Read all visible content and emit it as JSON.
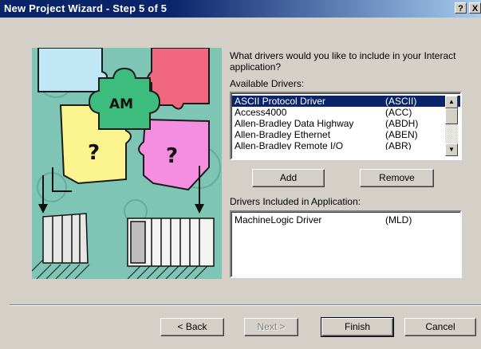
{
  "window": {
    "title": "New Project Wizard - Step 5 of 5",
    "help_label": "?",
    "close_label": "X"
  },
  "illustration": {
    "label_am": "AM",
    "label_q1": "?",
    "label_q2": "?"
  },
  "prompt": "What drivers would you like to include in your Interact application?",
  "available": {
    "label": "Available Drivers:",
    "items": [
      {
        "name": "ASCII Protocol Driver",
        "code": "(ASCII)",
        "selected": true
      },
      {
        "name": "Access4000",
        "code": "(ACC)"
      },
      {
        "name": "Allen-Bradley Data Highway",
        "code": "(ABDH)"
      },
      {
        "name": "Allen-Bradley Ethernet",
        "code": "(ABEN)"
      },
      {
        "name": "Allen-Bradley Remote I/O",
        "code": "(ABR)"
      }
    ]
  },
  "actions": {
    "add": "Add",
    "remove": "Remove"
  },
  "included": {
    "label": "Drivers Included in Application:",
    "items": [
      {
        "name": "MachineLogic Driver",
        "code": "(MLD)"
      }
    ]
  },
  "footer": {
    "back": "< Back",
    "next": "Next >",
    "finish": "Finish",
    "cancel": "Cancel"
  }
}
